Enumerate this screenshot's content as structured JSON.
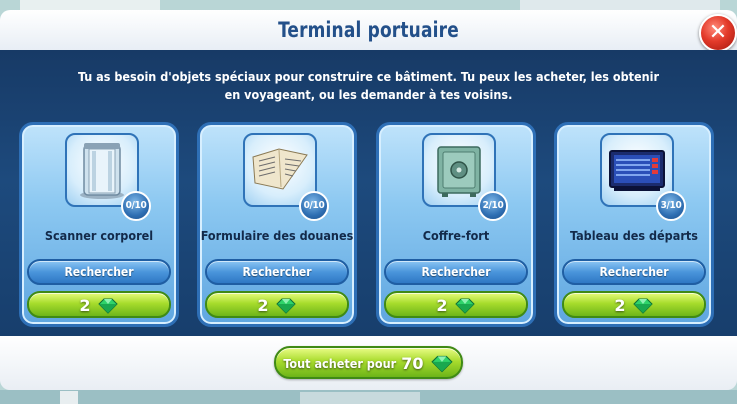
{
  "dialog": {
    "title": "Terminal portuaire",
    "close_symbol": "✕",
    "intro_line1": "Tu as besoin d'objets spéciaux pour construire ce bâtiment. Tu peux les acheter, les obtenir",
    "intro_line2": "en voyageant, ou les demander à tes voisins."
  },
  "items": [
    {
      "name": "Scanner corporel",
      "count": "0/10",
      "icon": "body-scanner-icon",
      "search_label": "Rechercher",
      "price": "2"
    },
    {
      "name": "Formulaire des douanes",
      "count": "0/10",
      "icon": "customs-form-icon",
      "search_label": "Rechercher",
      "price": "2"
    },
    {
      "name": "Coffre-fort",
      "count": "2/10",
      "icon": "safe-icon",
      "search_label": "Rechercher",
      "price": "2"
    },
    {
      "name": "Tableau des départs",
      "count": "3/10",
      "icon": "departures-board-icon",
      "search_label": "Rechercher",
      "price": "2"
    }
  ],
  "buy_all": {
    "label": "Tout acheter pour",
    "price": "70"
  },
  "colors": {
    "title": "#23508a",
    "panel": "#1d4a7d",
    "buy_green": "#a7dc2c",
    "search_blue": "#4a95db",
    "close_red": "#e33a2a"
  }
}
